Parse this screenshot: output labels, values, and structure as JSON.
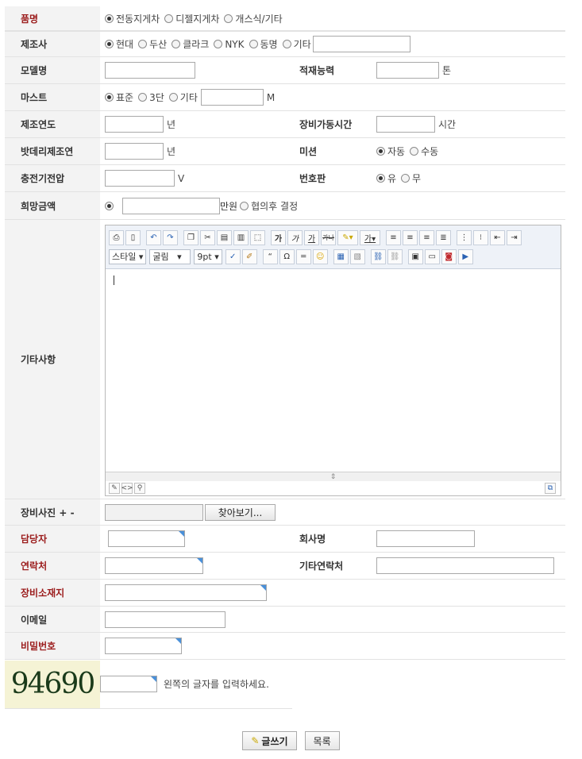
{
  "rows": {
    "product": {
      "label": "품명",
      "options": [
        "전동지게차",
        "디젤지게차",
        "개스식/기타"
      ],
      "selected": 0
    },
    "maker": {
      "label": "제조사",
      "options": [
        "현대",
        "두산",
        "클라크",
        "NYK",
        "동명",
        "기타"
      ],
      "selected": 0,
      "other_value": ""
    },
    "model": {
      "label": "모델명",
      "value": "",
      "capacity_label": "적재능력",
      "capacity_value": "",
      "capacity_unit": "톤"
    },
    "mast": {
      "label": "마스트",
      "options": [
        "표준",
        "3단",
        "기타"
      ],
      "selected": 0,
      "other_value": "",
      "unit": "M"
    },
    "year": {
      "label": "제조연도",
      "value": "",
      "unit": "년",
      "hours_label": "장비가동시간",
      "hours_value": "",
      "hours_unit": "시간"
    },
    "battery": {
      "label": "밧데리제조연",
      "value": "",
      "unit": "년",
      "mission_label": "미션",
      "mission_options": [
        "자동",
        "수동"
      ],
      "mission_selected": 0
    },
    "charger": {
      "label": "충전기전압",
      "value": "",
      "unit": "V",
      "plate_label": "번호판",
      "plate_options": [
        "유",
        "무"
      ],
      "plate_selected": 0
    },
    "price": {
      "label": "희망금액",
      "value": "",
      "unit": "만원",
      "negotiable": "협의후 결정"
    },
    "etc": {
      "label": "기타사항",
      "style_select": "스타일",
      "font_select": "굴림",
      "size_select": "9pt"
    },
    "photo": {
      "label": "장비사진 + -",
      "browse": "찾아보기..."
    },
    "manager": {
      "label": "담당자",
      "value": "",
      "company_label": "회사명",
      "company_value": ""
    },
    "contact": {
      "label": "연락처",
      "value": "",
      "other_label": "기타연락처",
      "other_value": ""
    },
    "location": {
      "label": "장비소재지",
      "value": ""
    },
    "email": {
      "label": "이메일",
      "value": ""
    },
    "password": {
      "label": "비밀번호",
      "value": ""
    },
    "captcha": {
      "code": "94690",
      "instruction": "왼쪽의 글자를 입력하세요.",
      "value": ""
    }
  },
  "buttons": {
    "write": "글쓰기",
    "list": "목록"
  },
  "colors": {
    "required_label": "#9b1c1c",
    "label_bg": "#f3f3f3"
  }
}
